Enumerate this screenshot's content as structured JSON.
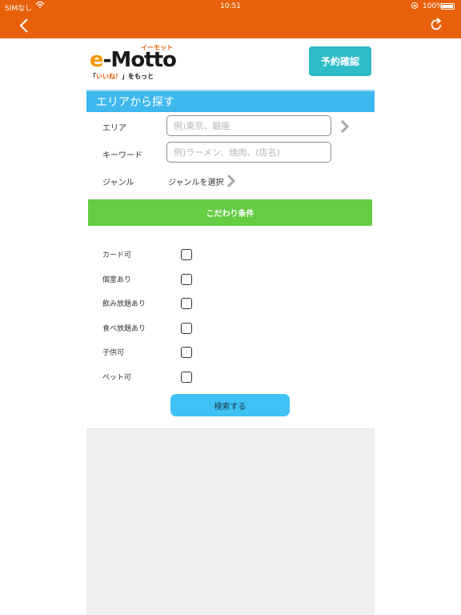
{
  "status_bar": {
    "carrier": "SIMなし",
    "time": "10:51",
    "battery": "100%"
  },
  "nav": {
    "back_icon": "chevron-left-icon",
    "refresh_icon": "refresh-icon",
    "bar_color": "#e8610a"
  },
  "logo": {
    "e": "e",
    "dash_m": "-M",
    "otto": "otto",
    "kana": "イーモット",
    "tag_before": "「",
    "tag_highlight": "いいね！",
    "tag_after": "」をもっと"
  },
  "reserve_button": "予約確認",
  "section": {
    "title": "エリアから探す"
  },
  "form": {
    "area_label": "エリア",
    "area_placeholder": "例)東京、銀座",
    "keyword_label": "キーワード",
    "keyword_placeholder": "例)ラーメン、焼肉、(店名)",
    "genre_label": "ジャンル",
    "genre_value": "ジャンルを選択"
  },
  "filter_bar": "こだわり条件",
  "options": [
    {
      "label": "カード可",
      "checked": false
    },
    {
      "label": "個室あり",
      "checked": false
    },
    {
      "label": "飲み放題あり",
      "checked": false
    },
    {
      "label": "食べ放題あり",
      "checked": false
    },
    {
      "label": "子供可",
      "checked": false
    },
    {
      "label": "ペット可",
      "checked": false
    }
  ],
  "search_button": "検索する",
  "colors": {
    "accent_orange": "#e8610a",
    "header_blue": "#3fb8ee",
    "filter_green": "#66cc44",
    "reserve_teal": "#2ebdc8",
    "search_blue": "#3fc1f4"
  }
}
